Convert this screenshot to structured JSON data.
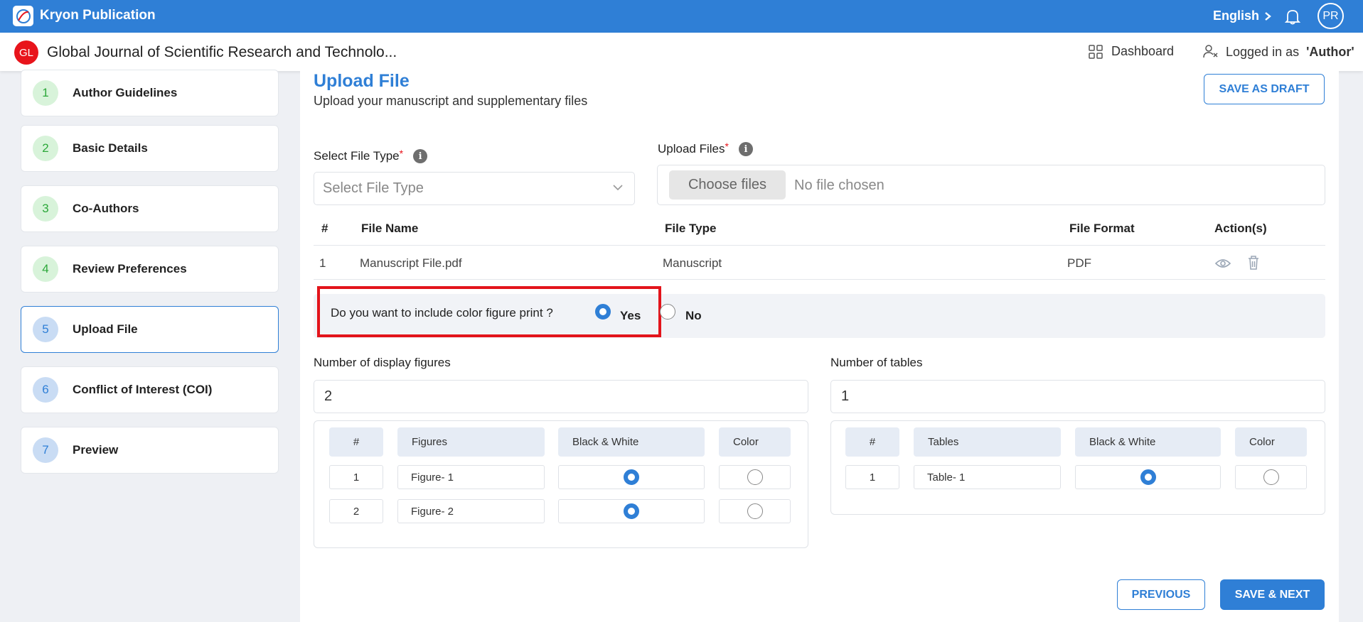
{
  "topbar": {
    "brand": "Kryon Publication",
    "language": "English",
    "avatar_initials": "PR"
  },
  "subbar": {
    "journal_badge": "GL",
    "journal_title": "Global Journal of Scientific Research and Technolo...",
    "dashboard_label": "Dashboard",
    "logged_prefix": "Logged in as",
    "logged_role": "'Author'"
  },
  "steps": [
    {
      "num": "1",
      "label": "Author Guidelines"
    },
    {
      "num": "2",
      "label": "Basic Details"
    },
    {
      "num": "3",
      "label": "Co-Authors"
    },
    {
      "num": "4",
      "label": "Review Preferences"
    },
    {
      "num": "5",
      "label": "Upload File"
    },
    {
      "num": "6",
      "label": "Conflict of Interest (COI)"
    },
    {
      "num": "7",
      "label": "Preview"
    }
  ],
  "page": {
    "title": "Upload File",
    "subtitle": "Upload your manuscript and supplementary files",
    "save_draft": "SAVE AS DRAFT",
    "previous": "PREVIOUS",
    "save_next": "SAVE & NEXT"
  },
  "form": {
    "file_type_label": "Select File Type",
    "file_type_placeholder": "Select File Type",
    "upload_label": "Upload Files",
    "required_mark": "*",
    "info_glyph": "i",
    "choose_btn": "Choose files",
    "no_file": "No file chosen"
  },
  "file_table": {
    "headers": [
      "#",
      "File Name",
      "File Type",
      "File Format",
      "Action(s)"
    ],
    "rows": [
      {
        "idx": "1",
        "name": "Manuscript File.pdf",
        "type": "Manuscript",
        "format": "PDF"
      }
    ]
  },
  "color_print": {
    "question": "Do you want to include color figure print ?",
    "yes": "Yes",
    "no": "No",
    "selected": "Yes"
  },
  "figures": {
    "label": "Number of display figures",
    "value": "2",
    "headers": [
      "#",
      "Figures",
      "Black & White",
      "Color"
    ],
    "rows": [
      {
        "idx": "1",
        "name": "Figure- 1",
        "mode": "bw"
      },
      {
        "idx": "2",
        "name": "Figure- 2",
        "mode": "bw"
      }
    ]
  },
  "tables": {
    "label": "Number of tables",
    "value": "1",
    "headers": [
      "#",
      "Tables",
      "Black & White",
      "Color"
    ],
    "rows": [
      {
        "idx": "1",
        "name": "Table- 1",
        "mode": "bw"
      }
    ]
  },
  "colors": {
    "primary": "#2f7fd6",
    "highlight": "#e3141b",
    "done_step": "#2ca83a",
    "journal_badge": "#e8141b"
  }
}
